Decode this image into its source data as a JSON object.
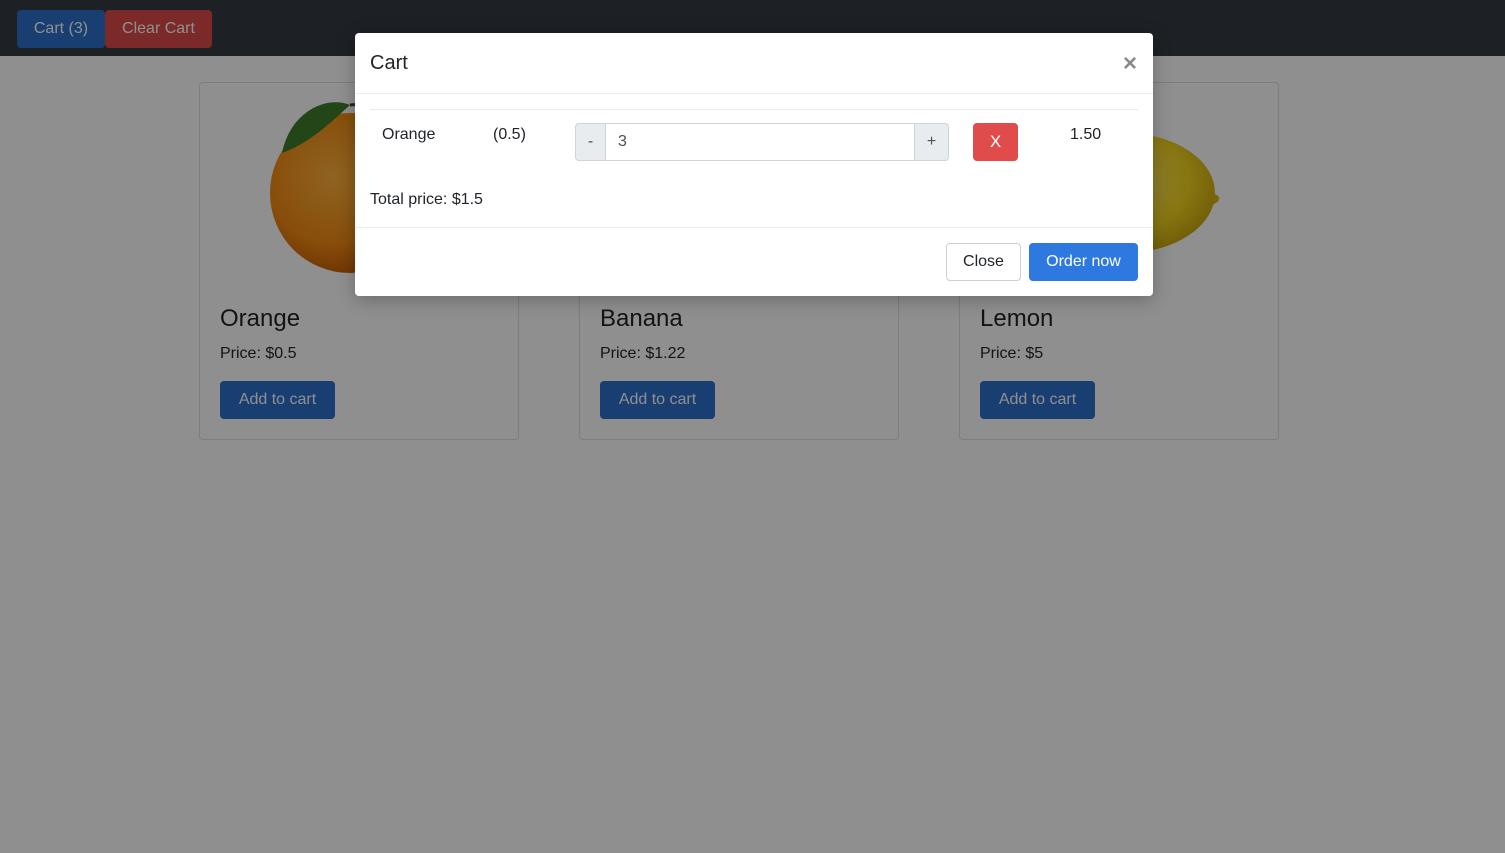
{
  "navbar": {
    "cart_label": "Cart (3)",
    "clear_label": "Clear Cart"
  },
  "products": [
    {
      "name": "Orange",
      "price": "Price: $0.5",
      "add_label": "Add to cart",
      "fruit": "orange"
    },
    {
      "name": "Banana",
      "price": "Price: $1.22",
      "add_label": "Add to cart",
      "fruit": "banana"
    },
    {
      "name": "Lemon",
      "price": "Price: $5",
      "add_label": "Add to cart",
      "fruit": "lemon"
    }
  ],
  "modal": {
    "title": "Cart",
    "close_glyph": "×",
    "items": [
      {
        "name": "Orange",
        "unit_price": "(0.5)",
        "minus": "-",
        "quantity": "3",
        "plus": "+",
        "remove": "X",
        "line_total": "1.50"
      }
    ],
    "total": "Total price: $1.5",
    "close_label": "Close",
    "order_label": "Order now"
  },
  "colors": {
    "primary": "#2d6fcc",
    "danger": "#dc4a4a",
    "navbar_bg": "#343a40",
    "order_button": "#2d79e0"
  }
}
